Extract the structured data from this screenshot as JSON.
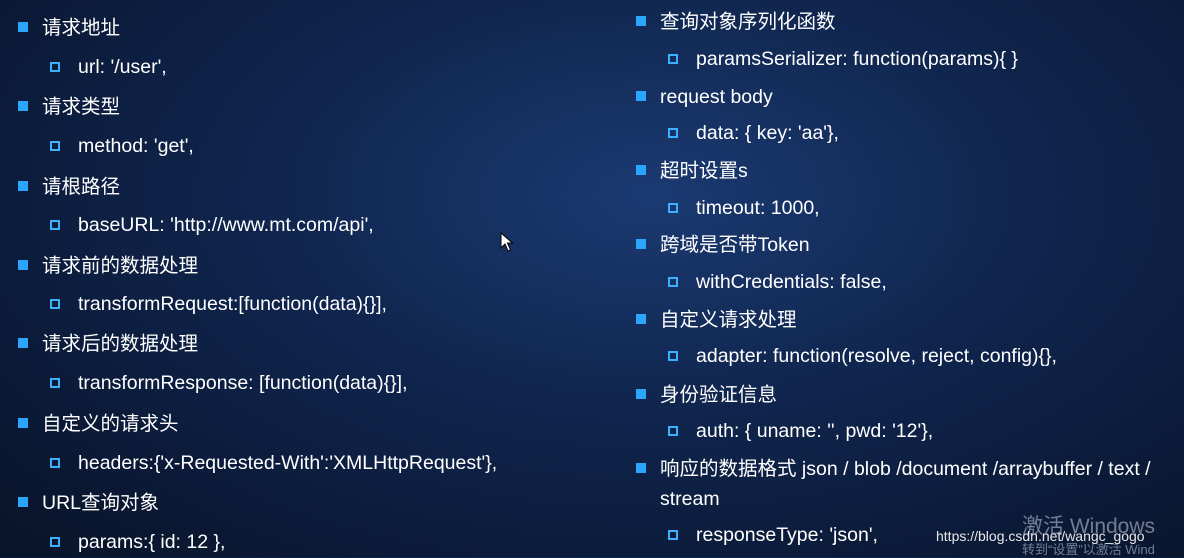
{
  "left": [
    {
      "title": "请求地址",
      "value": "url: '/user',"
    },
    {
      "title": "请求类型",
      "value": "method: 'get',"
    },
    {
      "title": "请根路径",
      "value": "baseURL: 'http://www.mt.com/api',"
    },
    {
      "title": "请求前的数据处理",
      "value": "transformRequest:[function(data){}],"
    },
    {
      "title": "请求后的数据处理",
      "value": "transformResponse: [function(data){}],"
    },
    {
      "title": "自定义的请求头",
      "value": "headers:{'x-Requested-With':'XMLHttpRequest'},"
    },
    {
      "title": "URL查询对象",
      "value": "params:{ id: 12 },"
    }
  ],
  "right": [
    {
      "title": "查询对象序列化函数",
      "value": "paramsSerializer: function(params){ }"
    },
    {
      "title": "request body",
      "value": "data: { key: 'aa'},"
    },
    {
      "title": "超时设置s",
      "value": "timeout: 1000,"
    },
    {
      "title": "跨域是否带Token",
      "value": "withCredentials: false,"
    },
    {
      "title": "自定义请求处理",
      "value": "adapter: function(resolve, reject, config){},"
    },
    {
      "title": "身份验证信息",
      "value": "auth: { uname: '', pwd: '12'},"
    },
    {
      "title": "响应的数据格式 json / blob /document /arraybuffer / text / stream",
      "value": "responseType: 'json',"
    }
  ],
  "watermark": "https://blog.csdn.net/wangc_gogo",
  "windows_activation": {
    "line1": "激活 Windows",
    "line2": "转到“设置”以激活 Wind"
  },
  "colors": {
    "bullet": "#2aa6ff",
    "text": "#ffffff",
    "background": "#10264f"
  },
  "icons": {
    "cursor": "mouse-pointer-icon"
  }
}
